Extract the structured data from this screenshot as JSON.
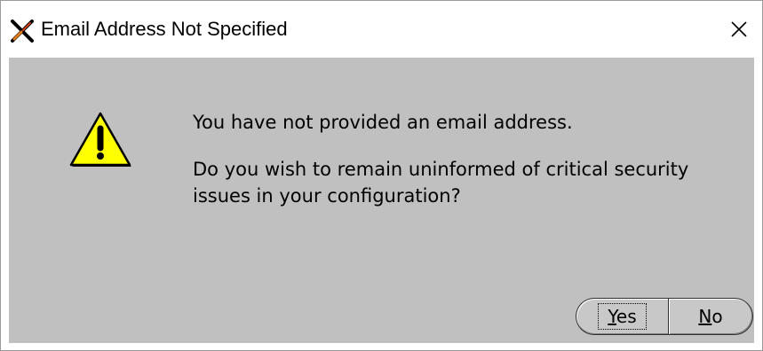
{
  "window": {
    "title": "Email Address Not Specified",
    "app_icon": "oracle-x-icon",
    "close_icon": "close-icon"
  },
  "dialog": {
    "icon": "warning-icon",
    "message_line1": "You have not provided an email address.",
    "message_line2": "Do you wish to remain uninformed of critical security issues in your configuration?",
    "yes_mnemonic": "Y",
    "yes_rest": "es",
    "no_mnemonic": "N",
    "no_rest": "o"
  },
  "colors": {
    "dialog_background": "#c0c0c0",
    "titlebar_background": "#ffffff",
    "warning_fill": "#ffff00"
  }
}
